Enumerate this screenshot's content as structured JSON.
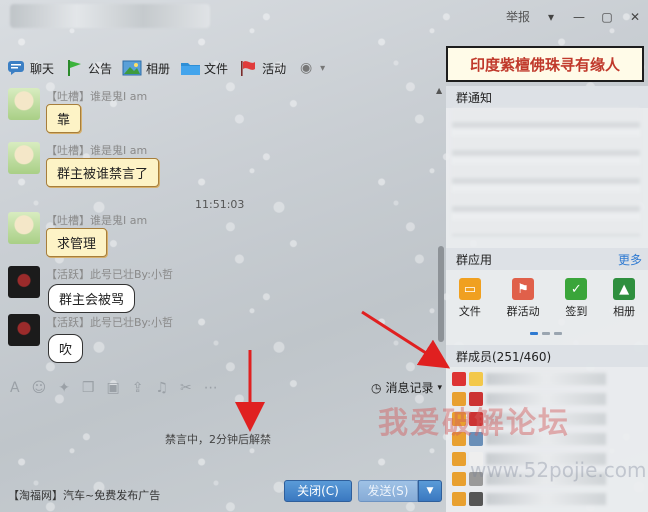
{
  "header": {
    "report_label": "举报",
    "menu_icon": "chevron-down-icon",
    "min_icon": "minimize-icon",
    "max_icon": "maximize-icon",
    "close_icon": "close-icon"
  },
  "toolbar": {
    "items": [
      {
        "label": "聊天",
        "icon": "chat-icon"
      },
      {
        "label": "公告",
        "icon": "flag-icon"
      },
      {
        "label": "相册",
        "icon": "photo-icon"
      },
      {
        "label": "文件",
        "icon": "folder-icon"
      },
      {
        "label": "活动",
        "icon": "heart-flag-icon"
      }
    ]
  },
  "banner": "印度紫檀佛珠寻有缘人",
  "chat": {
    "messages": [
      {
        "nick": "【吐槽】谁是鬼I am",
        "text": "靠"
      },
      {
        "nick": "【吐槽】谁是鬼I am",
        "text": "群主被谁禁言了"
      },
      {
        "nick": "【吐槽】谁是鬼I am",
        "text": "求管理"
      },
      {
        "nick": "【活跃】此号已壮By:小哲",
        "text": "群主会被骂"
      },
      {
        "nick": "【活跃】此号已壮By:小哲",
        "text": "吹"
      }
    ],
    "timestamp": "11:51:03"
  },
  "input": {
    "history_label": "消息记录",
    "mute_notice": "禁言中，2分钟后解禁"
  },
  "bottom": {
    "ad_text": "【淘福网】汽车~免费发布广告",
    "close_label": "关闭(C)",
    "send_label": "发送(S)"
  },
  "right": {
    "notice_title": "群通知",
    "apps_title": "群应用",
    "more_label": "更多",
    "apps": [
      {
        "label": "文件",
        "color": "#f0a020"
      },
      {
        "label": "群活动",
        "color": "#e0604a"
      },
      {
        "label": "签到",
        "color": "#3aa53a"
      },
      {
        "label": "相册",
        "color": "#2e8f3e"
      }
    ],
    "members_title": "群成员(251/460)"
  },
  "watermark": "我爱破解论坛",
  "watermark_url": "www.52pojie.com",
  "colors": {
    "accent": "#2f7ad1",
    "arrow": "#e02020"
  }
}
